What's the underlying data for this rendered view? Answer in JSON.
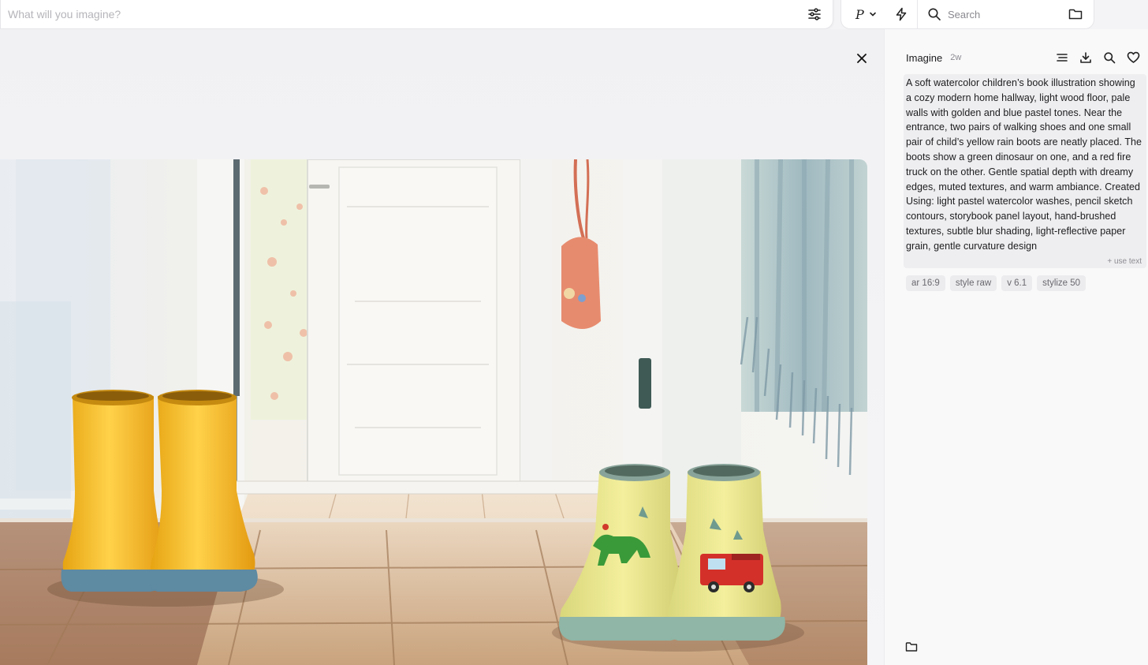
{
  "prompt_bar": {
    "placeholder": "What will you imagine?",
    "settings_icon": "sliders-icon"
  },
  "tools": {
    "mode_label": "P",
    "mode_icon": "chevron-down-icon",
    "bolt_icon": "lightning-icon",
    "search_placeholder": "Search",
    "folder_icon": "folder-icon"
  },
  "viewer": {
    "close_icon": "close-icon"
  },
  "side": {
    "title": "Imagine",
    "age": "2w",
    "actions": [
      "menu-icon",
      "download-icon",
      "search-icon",
      "heart-icon"
    ],
    "prompt": "A soft watercolor children’s book illustration showing a cozy modern home hallway, light wood floor, pale walls with golden and blue pastel tones. Near the entrance, two pairs of walking shoes and one small pair of child’s yellow rain boots are neatly placed. The boots show a green dinosaur on one, and a red fire truck on the other. Gentle spatial depth with dreamy edges, muted textures, and warm ambiance. Created Using: light pastel watercolor washes, pencil sketch contours, storybook panel layout, hand-brushed textures, subtle blur shading, light-reflective paper grain, gentle curvature design",
    "use_text": "+ use text",
    "chips": [
      "ar 16:9",
      "style raw",
      "v 6.1",
      "stylize 50"
    ]
  },
  "colors": {
    "panel_bg": "#f9f9fa",
    "prompt_box_bg": "#eeeef0",
    "boot_yellow": "#f2b21d",
    "floor_wood": "#d9b48a"
  }
}
